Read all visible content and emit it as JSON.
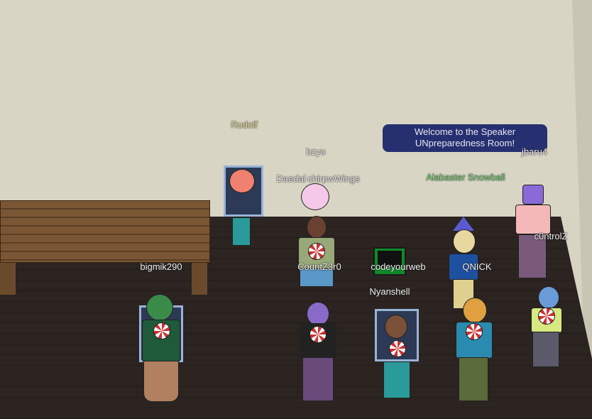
{
  "speech_bubble": {
    "text_line1": "Welcome to the Speaker",
    "text_line2": "UNpreparedness Room!"
  },
  "players": [
    {
      "name": "Rudolf",
      "color": "#e8e2a0"
    },
    {
      "name": "bzyo",
      "color": "#eeeeee"
    },
    {
      "name": "Daedal",
      "color": "#eeeeee"
    },
    {
      "name": "chirpwWings",
      "color": "#eeeeee"
    },
    {
      "name": "Alabaster Snowball",
      "color": "#7ed67a"
    },
    {
      "name": "jbaru4",
      "color": "#eeeeee"
    },
    {
      "name": "c0ntrolZ",
      "color": "#eeeeee"
    },
    {
      "name": "bigmik290",
      "color": "#eeeeee"
    },
    {
      "name": "CountZ3r0",
      "color": "#eeeeee"
    },
    {
      "name": "codeyourweb",
      "color": "#eeeeee"
    },
    {
      "name": "QNICK",
      "color": "#eeeeee"
    },
    {
      "name": "Nyanshell",
      "color": "#eeeeee"
    }
  ]
}
